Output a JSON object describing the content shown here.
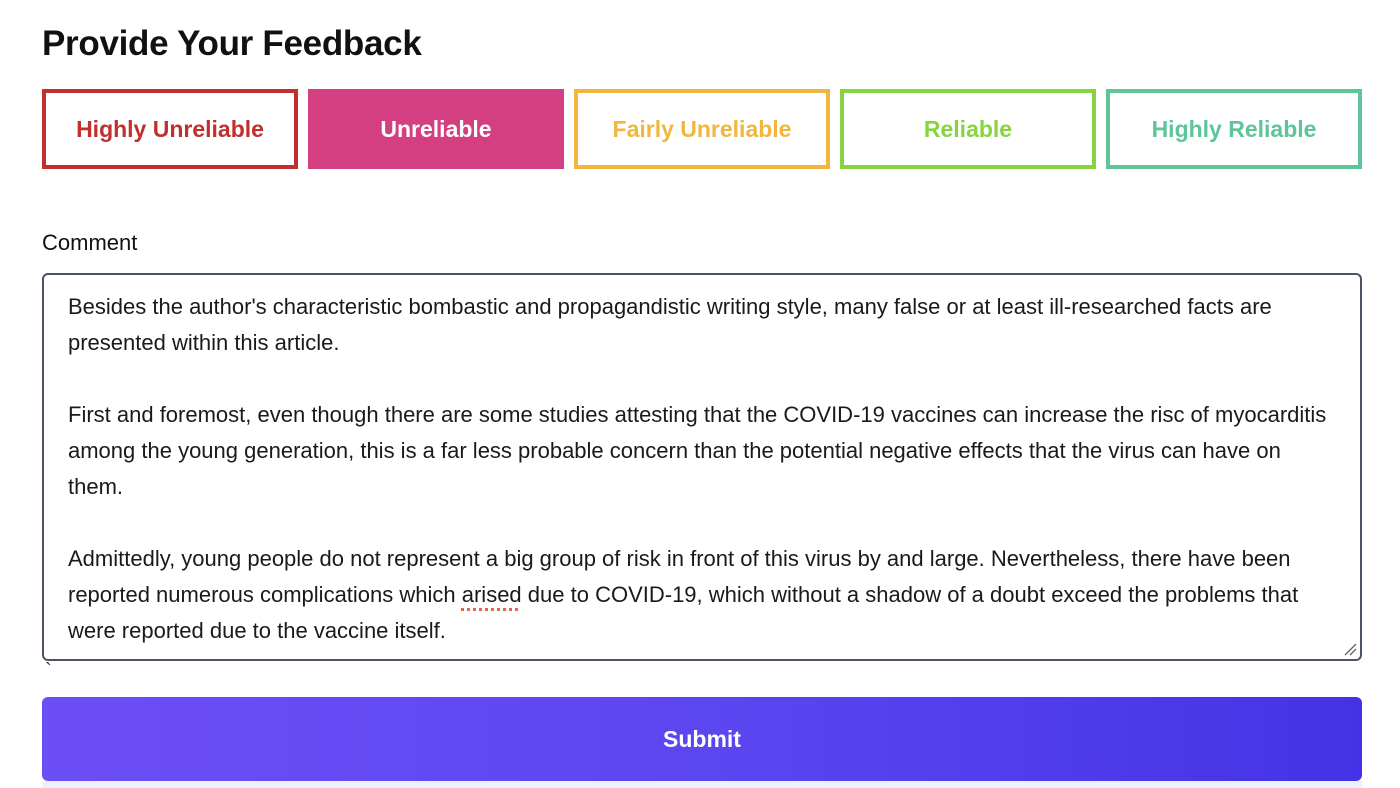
{
  "page": {
    "title": "Provide Your Feedback"
  },
  "ratings": [
    {
      "label": "Highly Unreliable",
      "selected": false,
      "color": "#c0302e"
    },
    {
      "label": "Unreliable",
      "selected": true,
      "color": "#d43f82"
    },
    {
      "label": "Fairly Unreliable",
      "selected": false,
      "color": "#f0b63f"
    },
    {
      "label": "Reliable",
      "selected": false,
      "color": "#86d43f"
    },
    {
      "label": "Highly Reliable",
      "selected": false,
      "color": "#5ec49a"
    }
  ],
  "comment": {
    "label": "Comment",
    "paragraph1": "Besides the author's characteristic bombastic and propagandistic writing style, many false or at least ill-researched facts are presented within this article.",
    "paragraph2": "First and foremost, even though there are some studies attesting that the COVID-19 vaccines can increase the risc of myocarditis among the young generation, this is a far less probable concern than the potential negative effects that the virus can have on them.",
    "paragraph3_before": "Admittedly, young people do not represent a big group of risk in front of this virus by and large. Nevertheless, there have been reported numerous complications which ",
    "paragraph3_misspelled": "arised",
    "paragraph3_after": " due to COVID-19, which without a shadow of a doubt exceed the problems that were reported due to the vaccine itself."
  },
  "stray_char": "`",
  "submit": {
    "label": "Submit",
    "gradient_start": "#6d4ef5",
    "gradient_end": "#4433e6"
  },
  "icons": {
    "resize_handle": "resize-handle-icon"
  }
}
